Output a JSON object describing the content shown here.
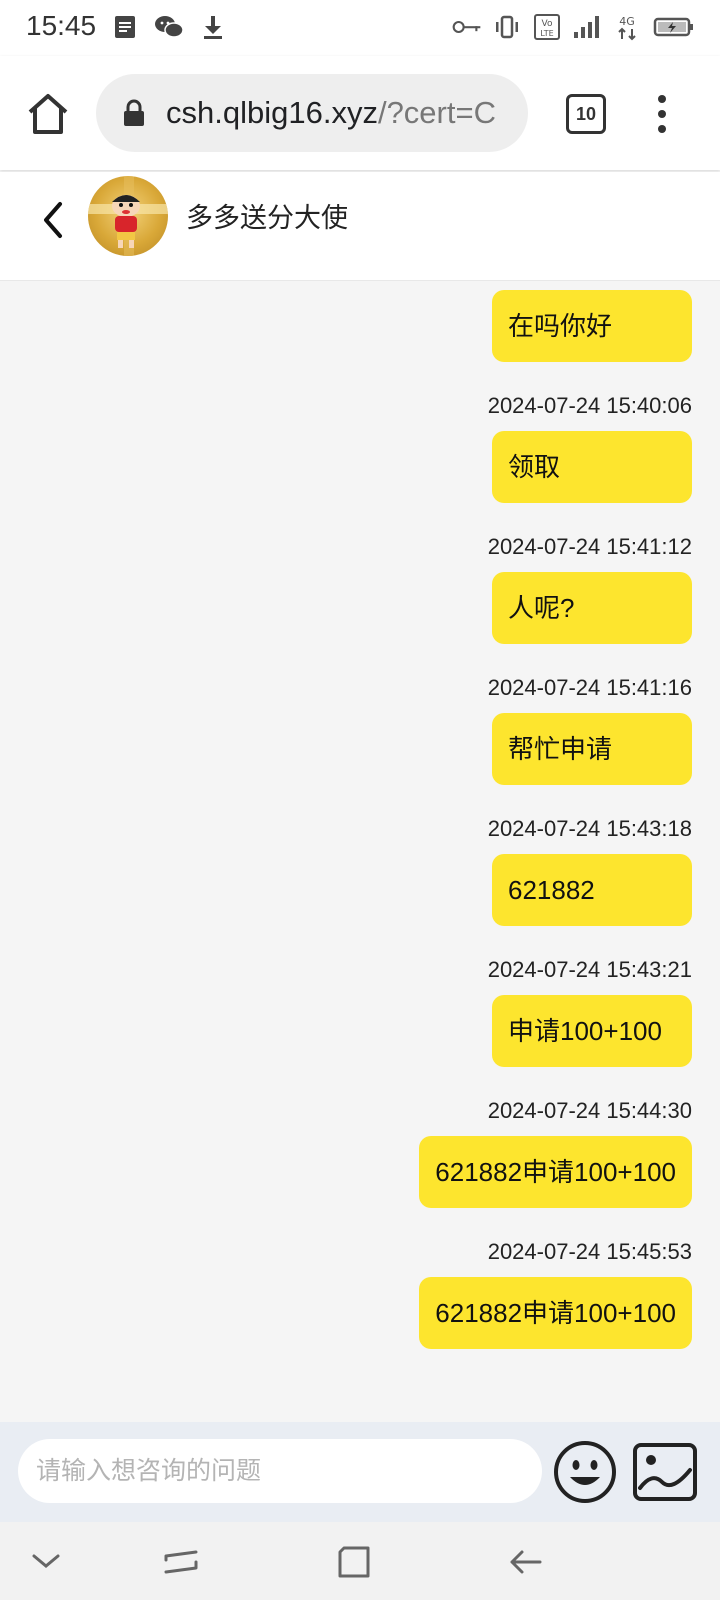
{
  "status_bar": {
    "time": "15:45",
    "left_icons": [
      "notes-icon",
      "wechat-icon",
      "download-icon"
    ],
    "right_icons": [
      "key-icon",
      "vibrate-icon",
      "volte-icon",
      "signal-icon",
      "4g-icon",
      "battery-charging-icon"
    ]
  },
  "browser": {
    "url_host": "csh.qlbig16.xyz",
    "url_path": "/?cert=C",
    "tab_count": "10"
  },
  "chat": {
    "title": "多多送分大使"
  },
  "messages": [
    {
      "timestamp": "",
      "text": "在吗你好"
    },
    {
      "timestamp": "2024-07-24 15:40:06",
      "text": "领取"
    },
    {
      "timestamp": "2024-07-24 15:41:12",
      "text": "人呢?"
    },
    {
      "timestamp": "2024-07-24 15:41:16",
      "text": "帮忙申请"
    },
    {
      "timestamp": "2024-07-24 15:43:18",
      "text": "621882"
    },
    {
      "timestamp": "2024-07-24 15:43:21",
      "text": "申请100+100"
    },
    {
      "timestamp": "2024-07-24 15:44:30",
      "text": "621882申请100+100"
    },
    {
      "timestamp": "2024-07-24 15:45:53",
      "text": "621882申请100+100"
    }
  ],
  "input": {
    "placeholder": "请输入想咨询的问题",
    "value": ""
  },
  "colors": {
    "bubble": "#fde52e",
    "chat_background": "#f5f5f5",
    "input_bar": "#e9edf3"
  }
}
